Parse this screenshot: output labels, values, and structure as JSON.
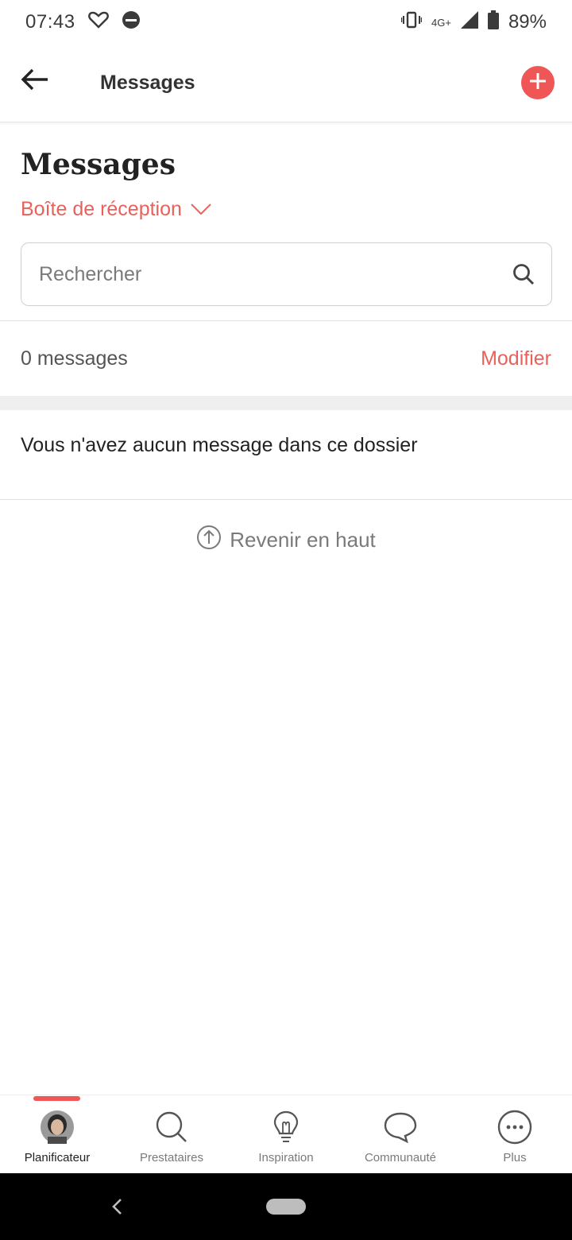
{
  "status_bar": {
    "time": "07:43",
    "battery": "89%",
    "network": "4G+",
    "icons": [
      "heart-outline-icon",
      "app-dot-icon",
      "vibrate-icon",
      "signal-icon",
      "battery-icon"
    ]
  },
  "app_bar": {
    "title": "Messages",
    "icons": [
      "back-arrow-icon",
      "plus-icon"
    ],
    "accent_color": "#ef5656"
  },
  "main": {
    "heading": "Messages",
    "folder_label": "Boîte de réception",
    "search": {
      "placeholder": "Rechercher",
      "value": ""
    },
    "count_text": "0 messages",
    "edit_label": "Modifier",
    "empty_text": "Vous n'avez aucun message dans ce dossier",
    "back_to_top_label": "Revenir en haut"
  },
  "bottom_nav": {
    "items": [
      {
        "label": "Planificateur",
        "icon": "avatar",
        "active": true
      },
      {
        "label": "Prestataires",
        "icon": "search-icon",
        "active": false
      },
      {
        "label": "Inspiration",
        "icon": "lightbulb-icon",
        "active": false
      },
      {
        "label": "Communauté",
        "icon": "chat-bubble-icon",
        "active": false
      },
      {
        "label": "Plus",
        "icon": "more-icon",
        "active": false
      }
    ]
  },
  "colors": {
    "accent": "#e8625c",
    "text_primary": "#222222",
    "text_secondary": "#7a7a7a"
  }
}
